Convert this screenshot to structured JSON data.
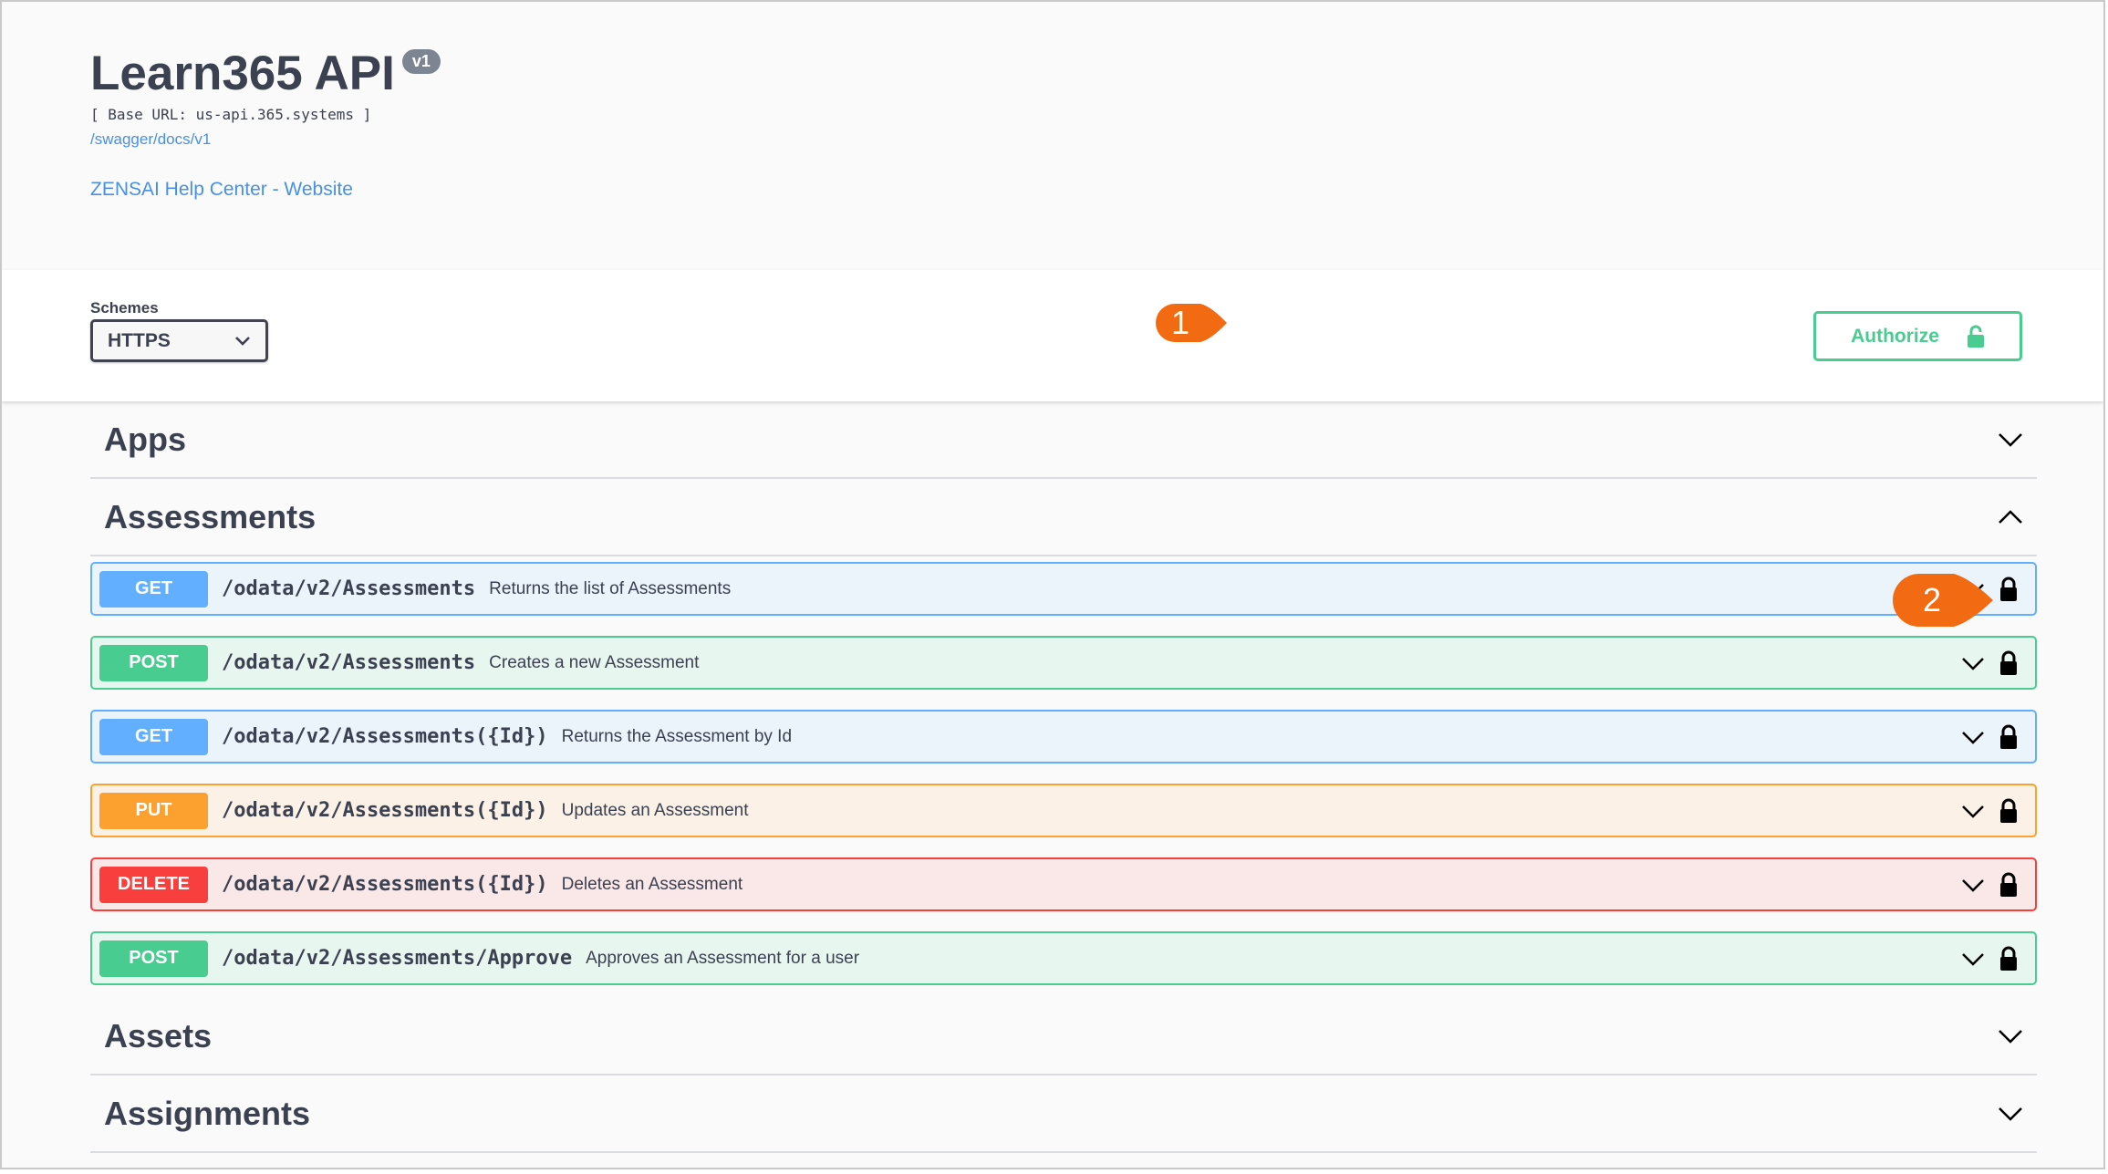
{
  "info": {
    "title": "Learn365 API",
    "version": "v1",
    "base_url": "[ Base URL: us-api.365.systems ]",
    "spec_link": "/swagger/docs/v1",
    "help_link": "ZENSAI Help Center - Website"
  },
  "schemes": {
    "label": "Schemes",
    "selected": "HTTPS"
  },
  "authorize": {
    "label": "Authorize",
    "icon": "unlock-icon"
  },
  "callouts": [
    "1",
    "2"
  ],
  "tags": [
    {
      "name": "Apps",
      "expanded": false
    },
    {
      "name": "Assessments",
      "expanded": true,
      "operations": [
        {
          "method": "GET",
          "path": "/odata/v2/Assessments",
          "summary": "Returns the list of Assessments"
        },
        {
          "method": "POST",
          "path": "/odata/v2/Assessments",
          "summary": "Creates a new Assessment"
        },
        {
          "method": "GET",
          "path": "/odata/v2/Assessments({Id})",
          "summary": "Returns the Assessment by Id"
        },
        {
          "method": "PUT",
          "path": "/odata/v2/Assessments({Id})",
          "summary": "Updates an Assessment"
        },
        {
          "method": "DELETE",
          "path": "/odata/v2/Assessments({Id})",
          "summary": "Deletes an Assessment"
        },
        {
          "method": "POST",
          "path": "/odata/v2/Assessments/Approve",
          "summary": "Approves an Assessment for a user"
        }
      ]
    },
    {
      "name": "Assets",
      "expanded": false
    },
    {
      "name": "Assignments",
      "expanded": false
    }
  ],
  "colors": {
    "get": "#61affe",
    "post": "#49cc90",
    "put": "#fca130",
    "delete": "#f93e3e",
    "callout": "#f26a12",
    "link": "#4990e2"
  }
}
